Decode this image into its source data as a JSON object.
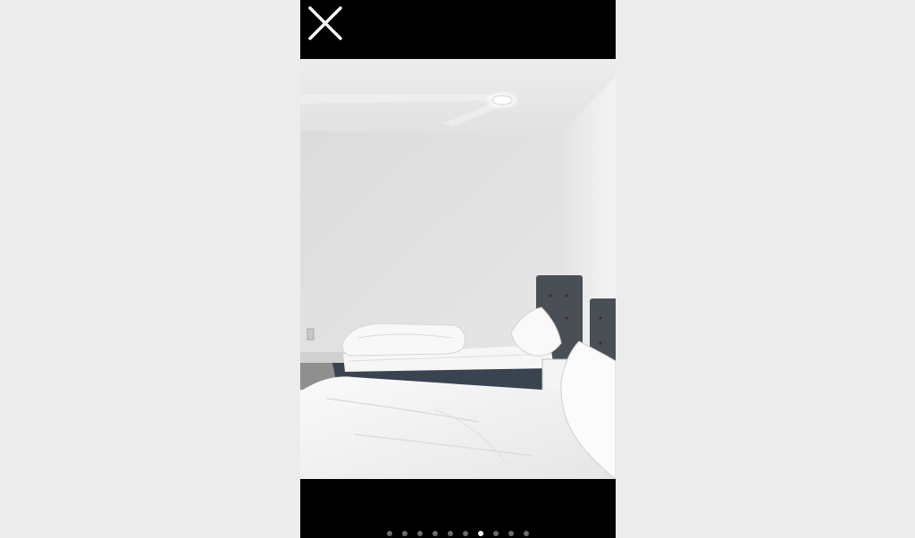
{
  "viewer": {
    "background_color": "#000000",
    "page_background_color": "#ececec",
    "close_icon": "close-icon",
    "photo": {
      "subject": "bedroom-photo"
    },
    "pagination": {
      "total": 10,
      "active_index": 6,
      "active_color": "#ffffff",
      "inactive_color": "#6b6b6b"
    }
  }
}
